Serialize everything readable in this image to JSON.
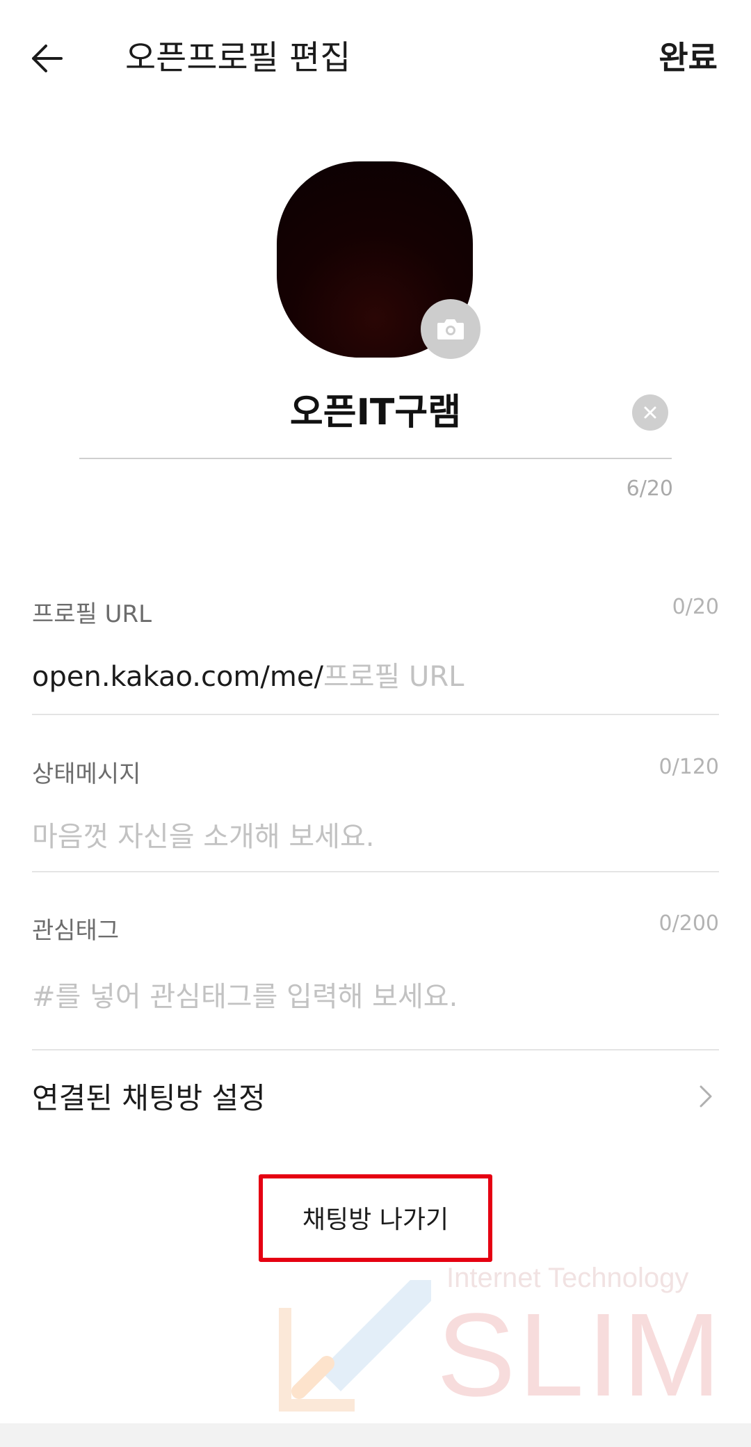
{
  "header": {
    "title": "오픈프로필 편집",
    "done_label": "완료"
  },
  "profile": {
    "name": "오픈IT구램",
    "name_count": "6/20"
  },
  "fields": {
    "url": {
      "label": "프로필 URL",
      "count": "0/20",
      "prefix": "open.kakao.com/me/",
      "placeholder": "프로필 URL"
    },
    "status": {
      "label": "상태메시지",
      "count": "0/120",
      "placeholder": "마음껏 자신을 소개해 보세요."
    },
    "tags": {
      "label": "관심태그",
      "count": "0/200",
      "placeholder": "#를 넣어 관심태그를 입력해 보세요."
    }
  },
  "linked_chat": {
    "label": "연결된 채팅방 설정"
  },
  "leave_button": {
    "label": "채팅방 나가기"
  },
  "watermark": {
    "line1": "Internet Technology",
    "line2": "SLIM"
  },
  "colors": {
    "highlight": "#e50012",
    "placeholder": "#c2c2c2"
  }
}
